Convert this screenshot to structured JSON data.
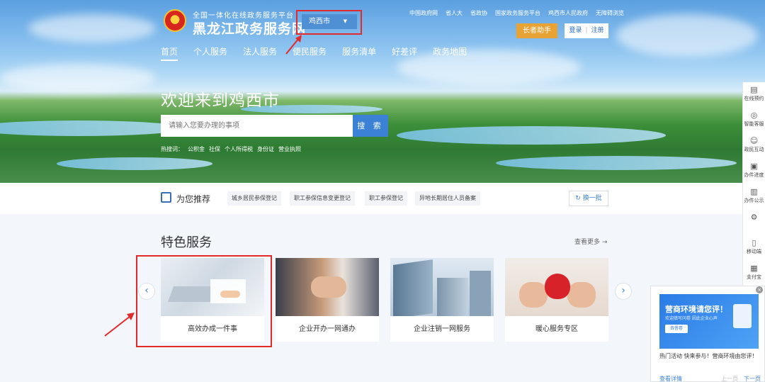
{
  "header": {
    "logo_sub": "全国一体化在线政务服务平台",
    "logo_main": "黑龙江政务服务网",
    "city": "鸡西市",
    "top_links": [
      "中国政府网",
      "省人大",
      "省政协",
      "国家政务服务平台",
      "鸡西市人民政府",
      "无障碍浏览"
    ],
    "elder_label": "长者助手",
    "login_label": "登录",
    "register_label": "注册"
  },
  "nav": {
    "items": [
      "首页",
      "个人服务",
      "法人服务",
      "便民服务",
      "服务清单",
      "好差评",
      "政务地图"
    ]
  },
  "hero": {
    "welcome": "欢迎来到鸡西市",
    "search_placeholder": "请输入您要办理的事项",
    "search_button": "搜 索",
    "hot_label": "热搜词：",
    "hot_words": [
      "公积金",
      "社保",
      "个人所得税",
      "身份证",
      "营业执照"
    ]
  },
  "recommend": {
    "title": "为您推荐",
    "tags": [
      "城乡居民参保登记",
      "职工参保信息变更登记",
      "职工参保登记",
      "异地长期居住人员备案"
    ],
    "refresh_label": "换一批"
  },
  "featured": {
    "title": "特色服务",
    "more_label": "查看更多 →",
    "cards": [
      "高效办成一件事",
      "企业开办一网通办",
      "企业注销一网服务",
      "暖心服务专区"
    ],
    "prev_icon": "chevron-left-icon",
    "next_icon": "chevron-right-icon"
  },
  "sidebar": {
    "items": [
      "在线预约",
      "智能客服",
      "政民互动",
      "办件进度",
      "办件公示",
      "",
      "移动端",
      "支付宝"
    ]
  },
  "popup": {
    "close_glyph": "×",
    "banner_title": "营商环境请您评！",
    "banner_sub": "欢迎填写问卷 因此企业心声",
    "banner_button": "去答卷",
    "text": "热门活动 快来参与！营商环境由您评！",
    "link_label": "查看详情",
    "prev_label": "上一页",
    "next_label": "下一页"
  },
  "colors": {
    "primary": "#3b82d6",
    "accent_orange": "#e8a334",
    "highlight_red": "#e32a2a"
  }
}
